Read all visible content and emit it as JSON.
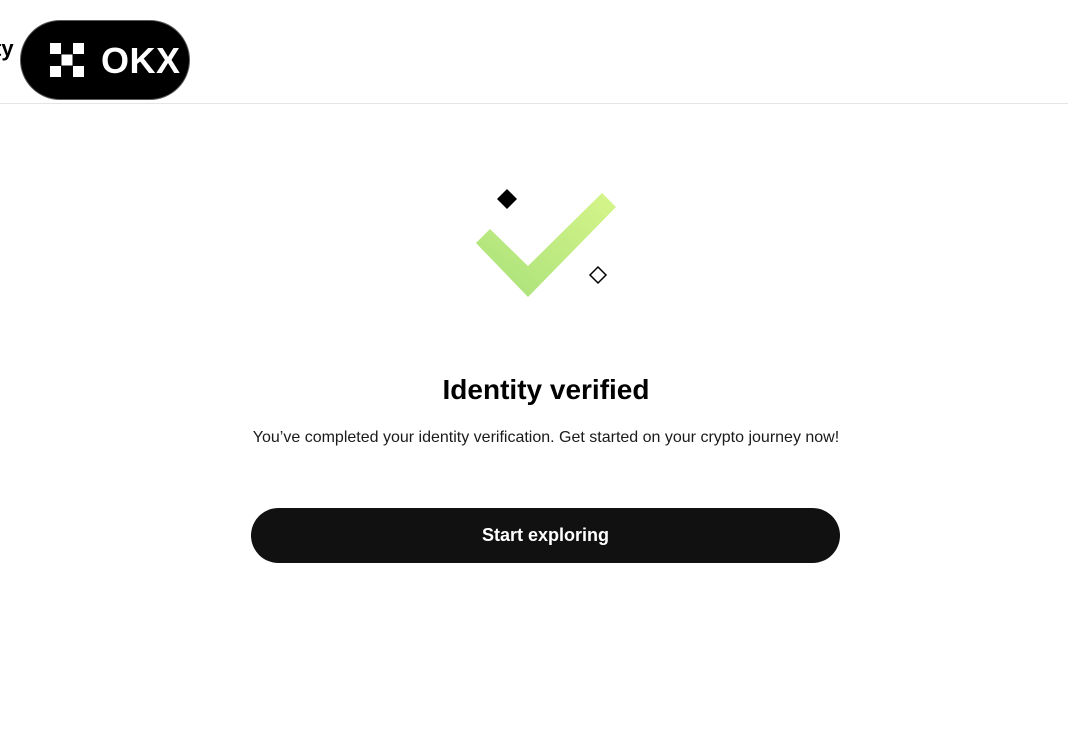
{
  "header": {
    "partial_title": "ty",
    "logo_text": "OKX",
    "logo_icon": "okx-logo-icon"
  },
  "main": {
    "illustration_icon": "checkmark-success-icon",
    "title": "Identity verified",
    "subtitle": "You’ve completed your identity verification. Get started on your crypto journey now!",
    "cta_label": "Start exploring"
  },
  "colors": {
    "button_bg": "#111111",
    "check_gradient_start": "#a8e07a",
    "check_gradient_end": "#d6f58a",
    "divider": "#e5e5e5"
  }
}
